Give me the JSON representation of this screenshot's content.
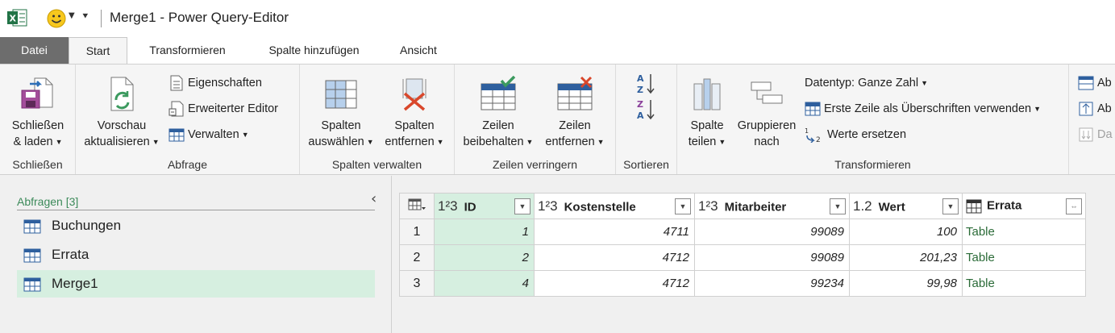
{
  "window": {
    "title": "Merge1 - Power Query-Editor"
  },
  "tabs": [
    "Datei",
    "Start",
    "Transformieren",
    "Spalte hinzufügen",
    "Ansicht"
  ],
  "ribbon": {
    "schliessen": {
      "btn_line1": "Schließen",
      "btn_line2": "& laden",
      "group": "Schließen"
    },
    "abfrage": {
      "vorschau_line1": "Vorschau",
      "vorschau_line2": "aktualisieren",
      "eigenschaften": "Eigenschaften",
      "erweiterter_editor": "Erweiterter Editor",
      "verwalten": "Verwalten",
      "group": "Abfrage"
    },
    "spalten_verwalten": {
      "auswaehlen_line1": "Spalten",
      "auswaehlen_line2": "auswählen",
      "entfernen_line1": "Spalten",
      "entfernen_line2": "entfernen",
      "group": "Spalten verwalten"
    },
    "zeilen_verringern": {
      "beibehalten_line1": "Zeilen",
      "beibehalten_line2": "beibehalten",
      "entfernen_line1": "Zeilen",
      "entfernen_line2": "entfernen",
      "group": "Zeilen verringern"
    },
    "sortieren": {
      "group": "Sortieren"
    },
    "transformieren": {
      "spalte_line1": "Spalte",
      "spalte_line2": "teilen",
      "gruppieren_line1": "Gruppieren",
      "gruppieren_line2": "nach",
      "datentyp": "Datentyp: Ganze Zahl",
      "erste_zeile": "Erste Zeile als Überschriften verwenden",
      "werte_ersetzen": "Werte ersetzen",
      "group": "Transformieren"
    },
    "cut": {
      "item1": "Ab",
      "item2": "Ab",
      "item3": "Da"
    }
  },
  "queries": {
    "header": "Abfragen [3]",
    "items": [
      "Buchungen",
      "Errata",
      "Merge1"
    ],
    "selected": "Merge1"
  },
  "table": {
    "columns": [
      {
        "type": "1²3",
        "name": "ID"
      },
      {
        "type": "1²3",
        "name": "Kostenstelle"
      },
      {
        "type": "1²3",
        "name": "Mitarbeiter"
      },
      {
        "type": "1.2",
        "name": "Wert"
      },
      {
        "type": "table",
        "name": "Errata"
      }
    ],
    "rows": [
      {
        "n": "1",
        "id": "1",
        "kostenstelle": "4711",
        "mitarbeiter": "99089",
        "wert": "100",
        "errata": "Table"
      },
      {
        "n": "2",
        "id": "2",
        "kostenstelle": "4712",
        "mitarbeiter": "99089",
        "wert": "201,23",
        "errata": "Table"
      },
      {
        "n": "3",
        "id": "4",
        "kostenstelle": "4712",
        "mitarbeiter": "99234",
        "wert": "99,98",
        "errata": "Table"
      }
    ]
  },
  "colors": {
    "accent_green": "#217346",
    "selection": "#d6efe0",
    "file_tab": "#6d6d6d"
  }
}
